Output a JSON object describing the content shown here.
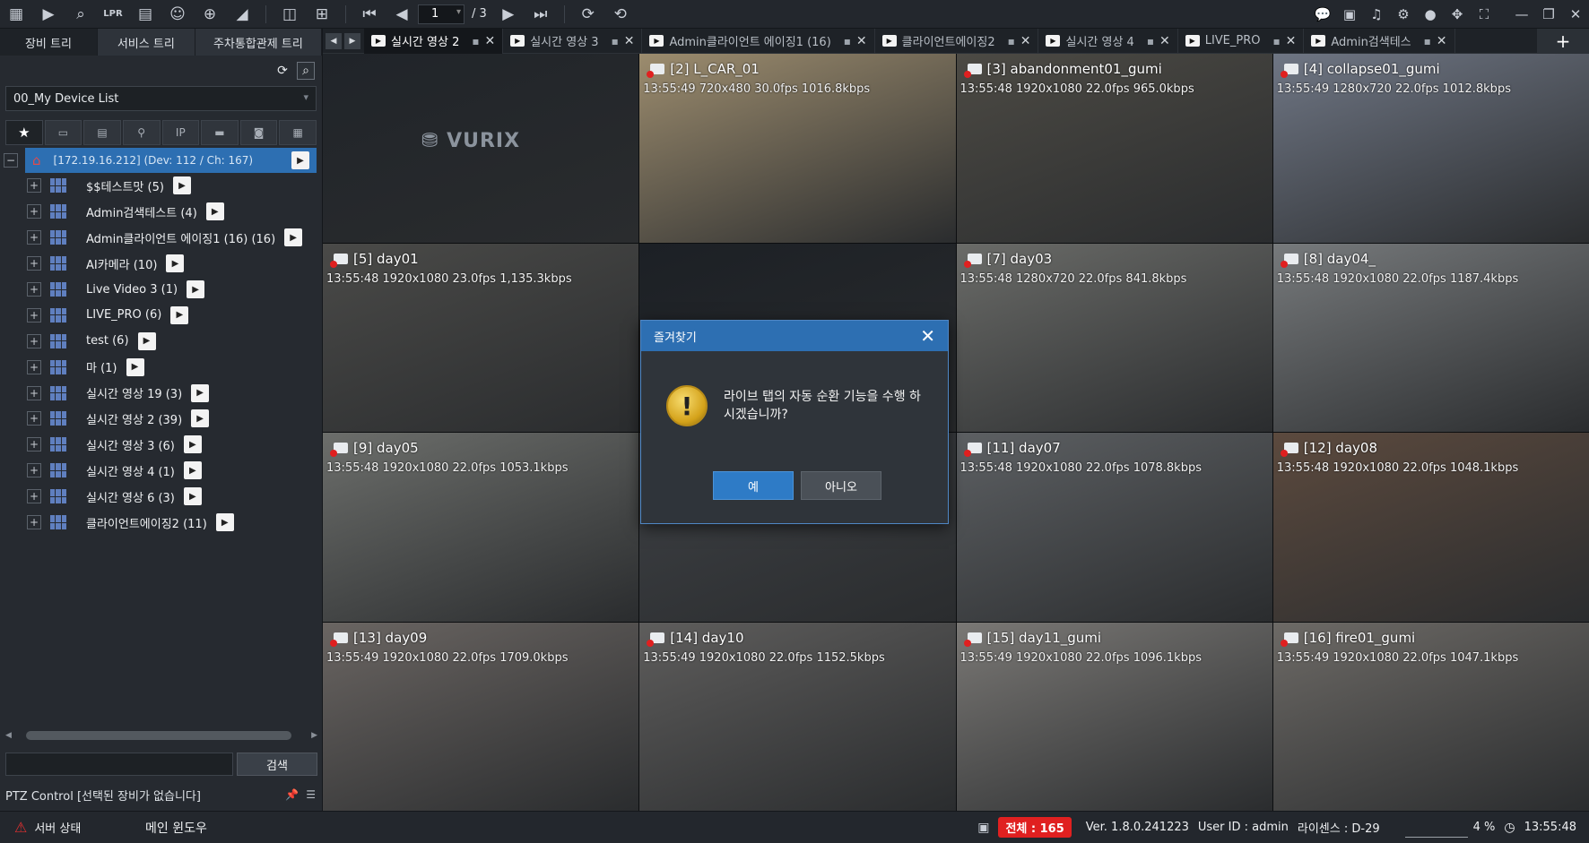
{
  "toolbar": {
    "left_icons": [
      "apps-grid-icon",
      "play-icon",
      "video-search-icon",
      "lpr-icon",
      "camera-list-icon",
      "person-search-icon",
      "map-marker-icon",
      "broadcast-icon"
    ],
    "layout_icons": [
      "layout-icon",
      "add-layout-icon"
    ],
    "first_label": "⏮",
    "prev_label": "◀",
    "next_label": "▶",
    "last_label": "⏭",
    "page_current": "1",
    "page_total": "/ 3",
    "lpr_label": "LPR",
    "right_icons": [
      "chat-icon",
      "monitor-icon",
      "bell-icon",
      "gear-icon",
      "user-icon",
      "move-icon",
      "fullscreen-icon",
      "minimize-icon",
      "restore-icon",
      "close-icon"
    ]
  },
  "sidebar": {
    "tabs": [
      "장비 트리",
      "서비스 트리",
      "주차통합관제 트리"
    ],
    "device_list": "00_My Device List",
    "filters": [
      "★",
      "▭",
      "▤",
      "⚲",
      "IP",
      "▬",
      "◙",
      "▦"
    ],
    "root": {
      "label": "[172.19.16.212] (Dev: 112 / Ch: 167)",
      "expander": "−"
    },
    "items": [
      {
        "label": "$$테스트맛 (5)"
      },
      {
        "label": "Admin검색테스트 (4)"
      },
      {
        "label": "Admin클라이언트 에이징1 (16) (16)"
      },
      {
        "label": "AI카메라 (10)"
      },
      {
        "label": "Live Video 3 (1)"
      },
      {
        "label": "LIVE_PRO (6)"
      },
      {
        "label": "test (6)"
      },
      {
        "label": "마 (1)"
      },
      {
        "label": "실시간 영상 19 (3)"
      },
      {
        "label": "실시간 영상 2 (39)"
      },
      {
        "label": "실시간 영상 3 (6)"
      },
      {
        "label": "실시간 영상 4 (1)"
      },
      {
        "label": "실시간 영상 6 (3)"
      },
      {
        "label": "클라이언트에이징2 (11)"
      }
    ],
    "expand_symbol": "+",
    "play_symbol": "▶",
    "search_button": "검색",
    "ptz_label": "PTZ Control [선택된 장비가 없습니다]"
  },
  "tabs": [
    {
      "label": "실시간 영상 2",
      "active": true
    },
    {
      "label": "실시간 영상 3",
      "active": false
    },
    {
      "label": "Admin클라이언트 에이징1 (16)",
      "active": false
    },
    {
      "label": "클라이언트에이징2",
      "active": false
    },
    {
      "label": "실시간 영상 4",
      "active": false
    },
    {
      "label": "LIVE_PRO",
      "active": false
    },
    {
      "label": "Admin검색테스",
      "active": false
    }
  ],
  "tab_add": "+",
  "cameras": [
    {
      "title": "",
      "info": "",
      "logo": "⛃ VURIX",
      "bg": "#202429"
    },
    {
      "title": "[2] L_CAR_01",
      "info": "13:55:49 720x480 30.0fps 1016.8kbps",
      "bg": "#9c8c6e"
    },
    {
      "title": "[3] abandonment01_gumi",
      "info": "13:55:48 1920x1080 22.0fps 965.0kbps",
      "bg": "#4c4a44"
    },
    {
      "title": "[4] collapse01_gumi",
      "info": "13:55:49 1280x720 22.0fps 1012.8kbps",
      "bg": "#6f7684"
    },
    {
      "title": "[5] day01",
      "info": "13:55:48 1920x1080 23.0fps 1,135.3kbps",
      "bg": "#4a4a48"
    },
    {
      "title": "",
      "info": "",
      "bg": "#1c2025"
    },
    {
      "title": "[7] day03",
      "info": "13:55:48 1280x720 22.0fps 841.8kbps",
      "bg": "#6a6b68"
    },
    {
      "title": "[8] day04_",
      "info": "13:55:48 1920x1080 22.0fps 1187.4kbps",
      "bg": "#777a7c"
    },
    {
      "title": "[9] day05",
      "info": "13:55:48 1920x1080 22.0fps 1053.1kbps",
      "bg": "#6c6e6b"
    },
    {
      "title": "",
      "info": "",
      "bg": "#3f4246"
    },
    {
      "title": "[11] day07",
      "info": "13:55:48 1920x1080 22.0fps 1078.8kbps",
      "bg": "#5d6063"
    },
    {
      "title": "[12] day08",
      "info": "13:55:48 1920x1080 22.0fps 1048.1kbps",
      "bg": "#5c4a3e"
    },
    {
      "title": "[13] day09",
      "info": "13:55:49 1920x1080 22.0fps 1709.0kbps",
      "bg": "#6a6562"
    },
    {
      "title": "[14] day10",
      "info": "13:55:49 1920x1080 22.0fps 1152.5kbps",
      "bg": "#5e5d5c"
    },
    {
      "title": "[15] day11_gumi",
      "info": "13:55:49 1920x1080 22.0fps 1096.1kbps",
      "bg": "#7a7875"
    },
    {
      "title": "[16] fire01_gumi",
      "info": "13:55:49 1920x1080 22.0fps 1047.1kbps",
      "bg": "#6d6a66"
    }
  ],
  "dialog": {
    "title": "즐겨찾기",
    "close": "✕",
    "icon": "!",
    "message": "라이브 탭의 자동 순환 기능을 수행 하시겠습니까?",
    "yes": "예",
    "no": "아니오"
  },
  "status": {
    "server_state": "서버 상태",
    "warn": "⚠",
    "main_window": "메인 윈도우",
    "total": "전체 : 165",
    "version": "Ver. 1.8.0.241223",
    "user": "User ID : admin",
    "license": "라이센스 : D-29",
    "cpu": "4 %",
    "time": "13:55:48"
  }
}
